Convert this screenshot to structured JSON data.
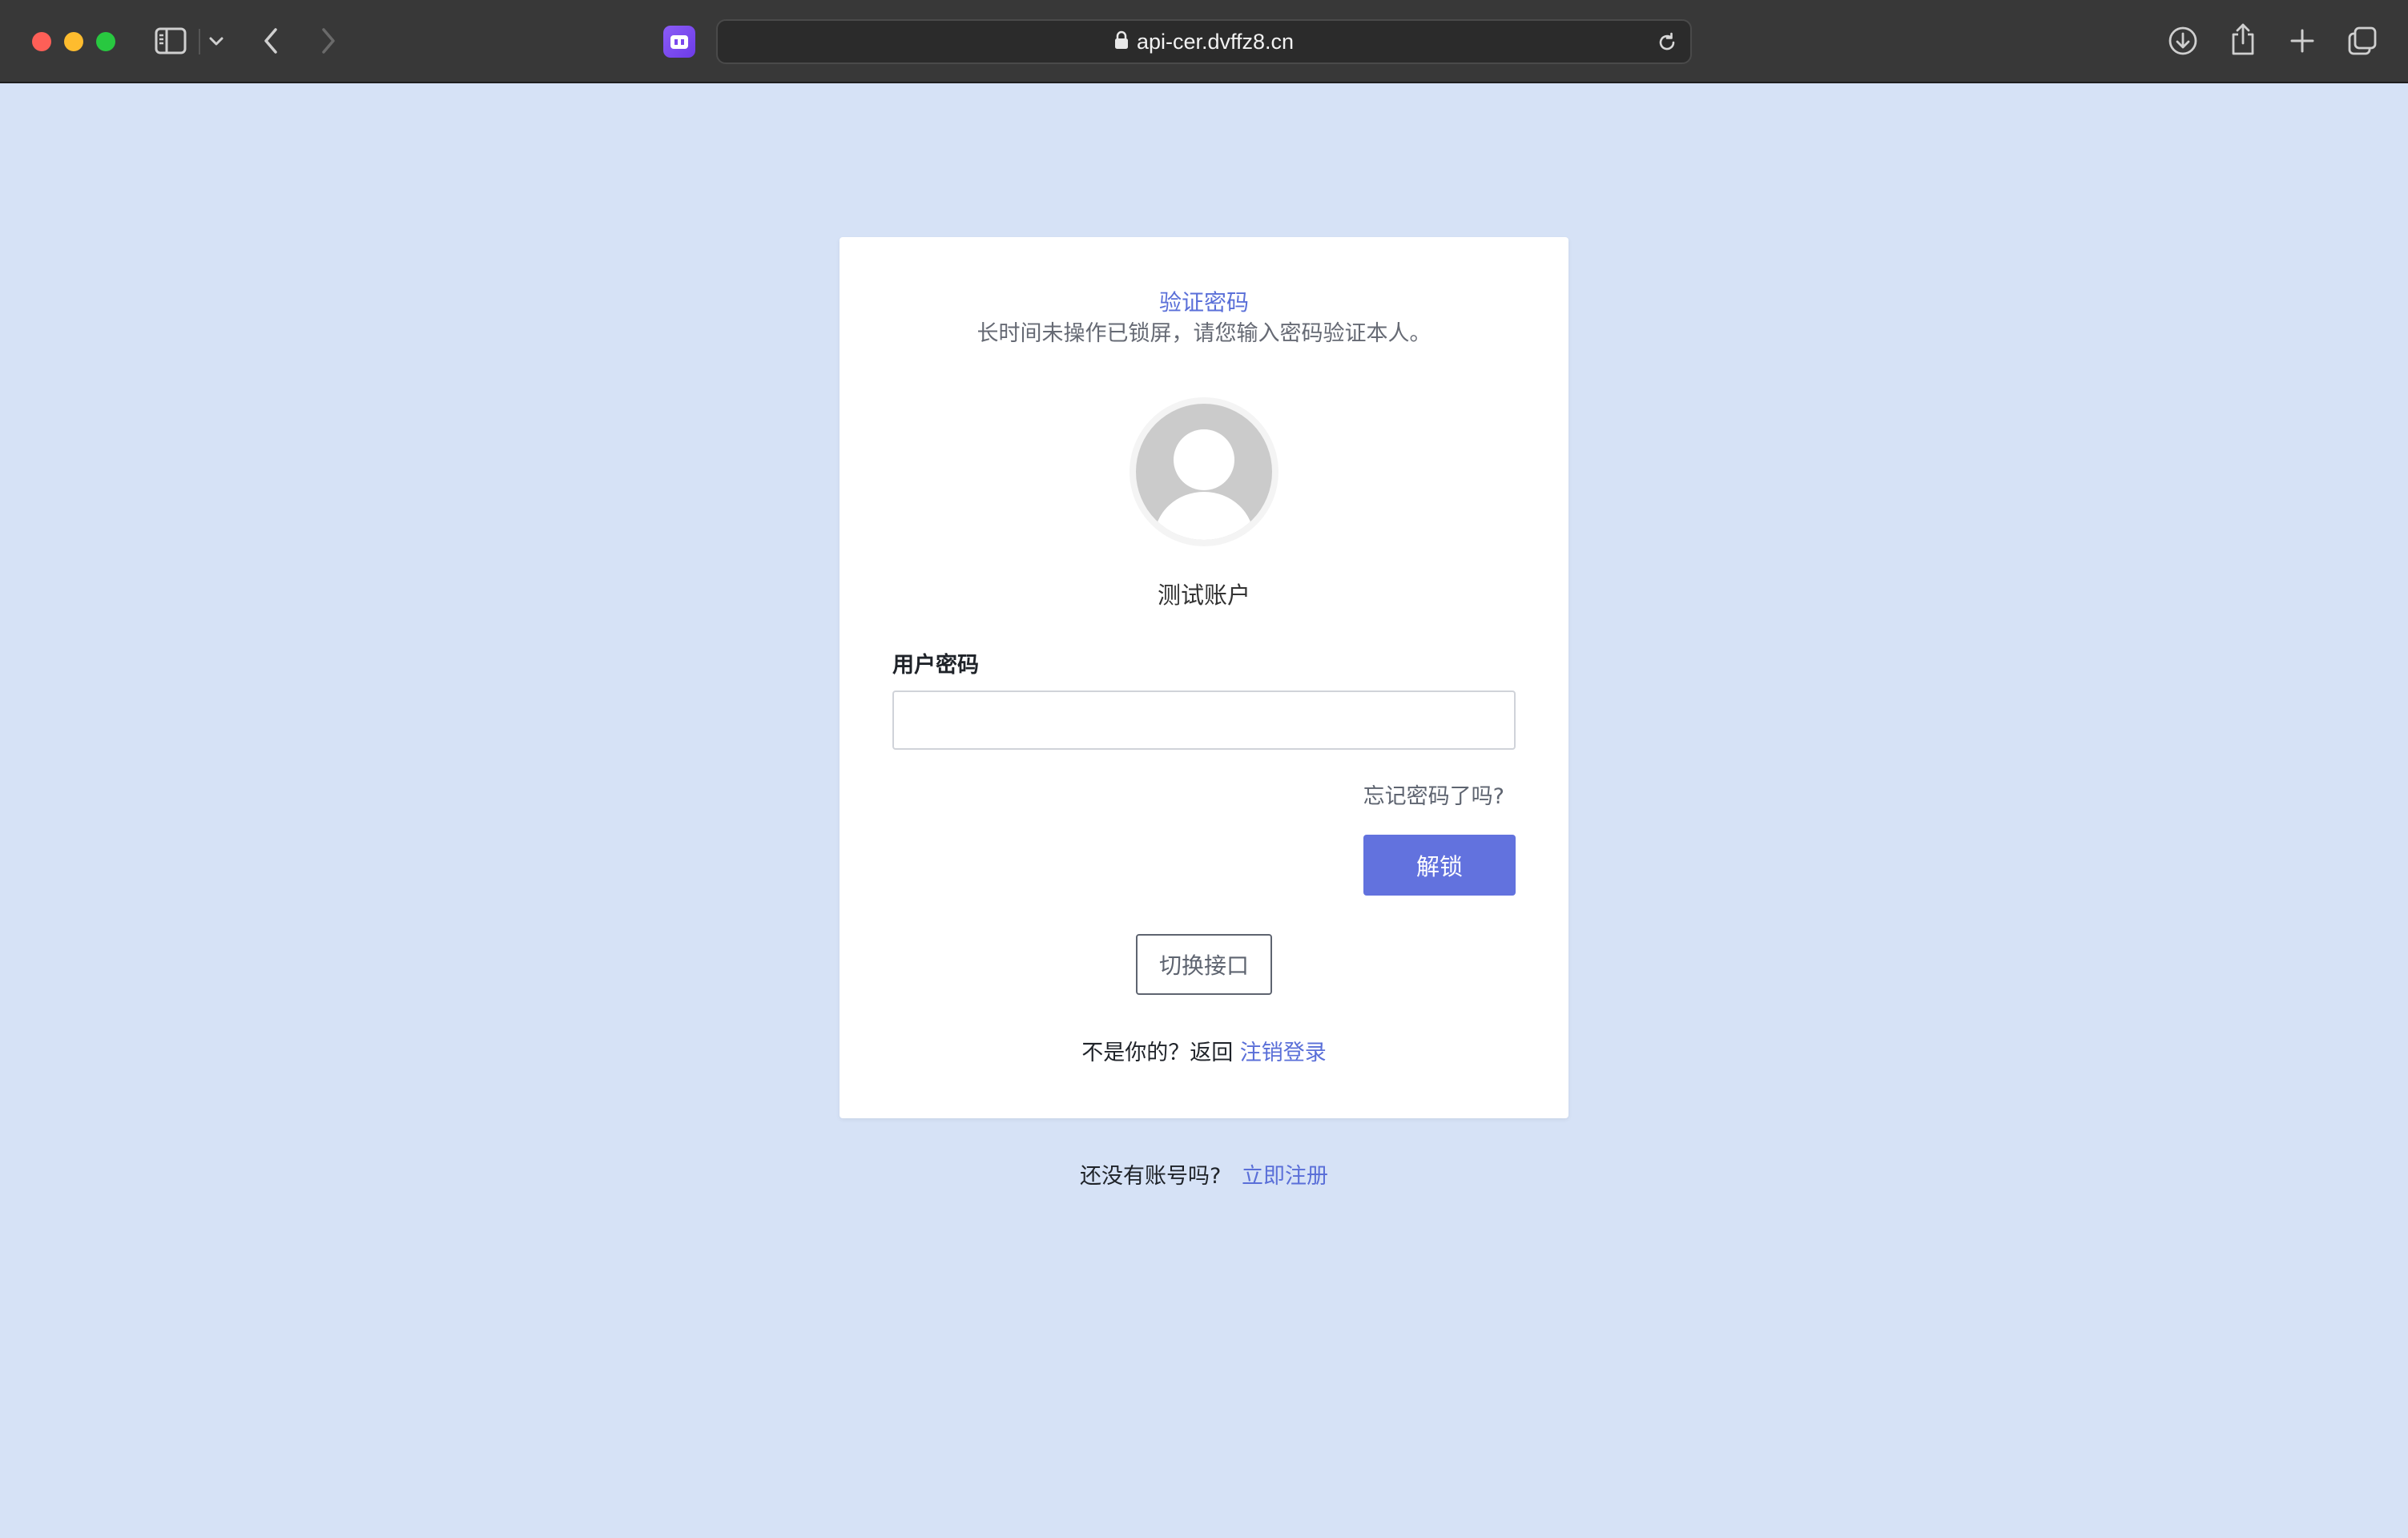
{
  "browser": {
    "url": "api-cer.dvffz8.cn",
    "icons": {
      "sidebar": "sidebar-icon",
      "back": "chevron-left-icon",
      "forward": "chevron-right-icon",
      "lock": "lock-icon",
      "reload": "reload-icon",
      "download": "download-icon",
      "share": "share-icon",
      "new_tab": "plus-icon",
      "tabs": "tabs-overview-icon"
    }
  },
  "lock_card": {
    "title": "验证密码",
    "subtitle": "长时间未操作已锁屏，请您输入密码验证本人。",
    "username": "测试账户",
    "password_label": "用户密码",
    "password_value": "",
    "password_placeholder": "",
    "forgot_link": "忘记密码了吗?",
    "unlock_button": "解锁",
    "switch_button": "切换接口",
    "not_you_text": "不是你的？返回",
    "logout_link": "注销登录"
  },
  "footer": {
    "no_account_text": "还没有账号吗?",
    "register_link": "立即注册"
  },
  "colors": {
    "page_bg": "#d6e2f6",
    "accent": "#5a6fd8",
    "button_bg": "#6272de"
  }
}
